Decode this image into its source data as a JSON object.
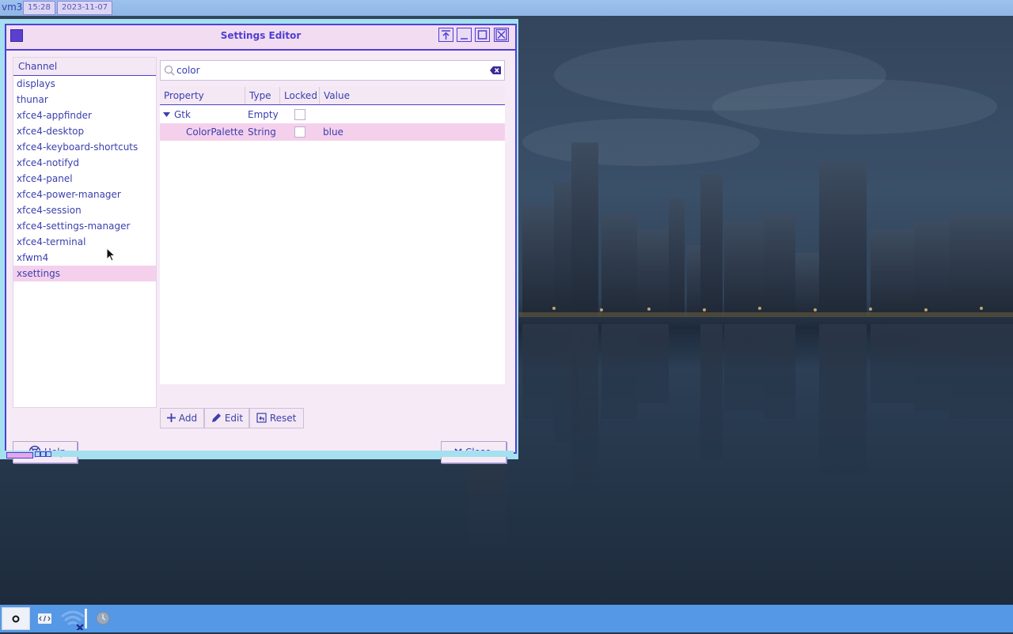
{
  "top_panel": {
    "workspace": "vm3",
    "time": "15:28",
    "date": "2023-11-07"
  },
  "window": {
    "title": "Settings Editor"
  },
  "channels": {
    "header": "Channel",
    "items": [
      "displays",
      "thunar",
      "xfce4-appfinder",
      "xfce4-desktop",
      "xfce4-keyboard-shortcuts",
      "xfce4-notifyd",
      "xfce4-panel",
      "xfce4-power-manager",
      "xfce4-session",
      "xfce4-settings-manager",
      "xfce4-terminal",
      "xfwm4",
      "xsettings"
    ],
    "selected": "xsettings"
  },
  "search": {
    "value": "color"
  },
  "table": {
    "columns": [
      "Property",
      "Type",
      "Locked",
      "Value"
    ],
    "rows": [
      {
        "property": "Gtk",
        "type": "Empty",
        "locked": false,
        "value": ""
      },
      {
        "property": "ColorPalette",
        "type": "String",
        "locked": false,
        "value": "blue"
      }
    ]
  },
  "toolbar": {
    "add": "Add",
    "edit": "Edit",
    "reset": "Reset"
  },
  "dialog": {
    "help": "Help",
    "close": "Close"
  },
  "icons": [
    "search-icon",
    "clear-icon",
    "expander-icon",
    "add-icon",
    "edit-icon",
    "reset-icon",
    "help-icon",
    "close-icon"
  ],
  "colors": {
    "accent": "#4f3fd0",
    "selection": "#f5d0ec",
    "window_bg": "#f6eaf6",
    "panel": "#5598e6"
  }
}
